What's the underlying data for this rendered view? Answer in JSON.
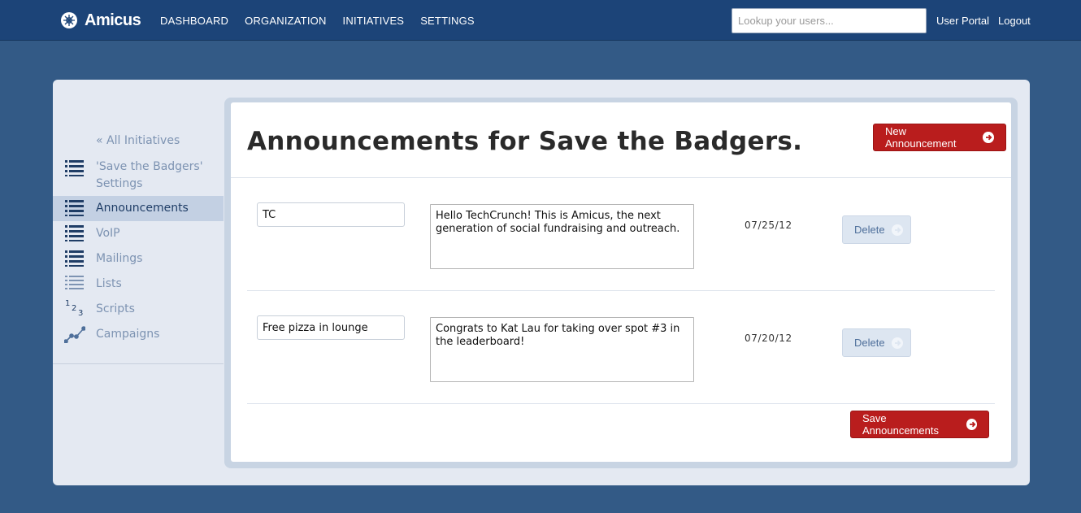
{
  "app": {
    "brand": "Amicus",
    "nav": [
      "DASHBOARD",
      "ORGANIZATION",
      "INITIATIVES",
      "SETTINGS"
    ],
    "search_placeholder": "Lookup your users...",
    "user_portal": "User Portal",
    "logout": "Logout"
  },
  "sidebar": {
    "back": "« All Initiatives",
    "items": [
      {
        "label": "'Save the Badgers' Settings",
        "icon": "list-icon",
        "active": false
      },
      {
        "label": "Announcements",
        "icon": "list-icon",
        "active": true
      },
      {
        "label": "VoIP",
        "icon": "list-icon",
        "active": false
      },
      {
        "label": "Mailings",
        "icon": "list-icon",
        "active": false
      },
      {
        "label": "Lists",
        "icon": "list-icon",
        "active": false
      },
      {
        "label": "Scripts",
        "icon": "numbered-list-icon",
        "active": false
      },
      {
        "label": "Campaigns",
        "icon": "line-graph-icon",
        "active": false
      }
    ]
  },
  "main": {
    "title": "Announcements for Save the Badgers.",
    "new_button": "New Announcement",
    "save_button": "Save Announcements",
    "announcements": [
      {
        "title": "TC",
        "body": "Hello TechCrunch! This is Amicus, the next generation of social fundraising and outreach.",
        "date": "07/25/12",
        "delete_label": "Delete"
      },
      {
        "title": "Free pizza in lounge",
        "body": "Congrats to Kat Lau for taking over spot #3 in the leaderboard!",
        "date": "07/20/12",
        "delete_label": "Delete"
      }
    ]
  },
  "colors": {
    "background": "#335a86",
    "topbar": "#1c4478",
    "accent_red": "#b91d1d",
    "active_nav": "#c3d0e3"
  }
}
